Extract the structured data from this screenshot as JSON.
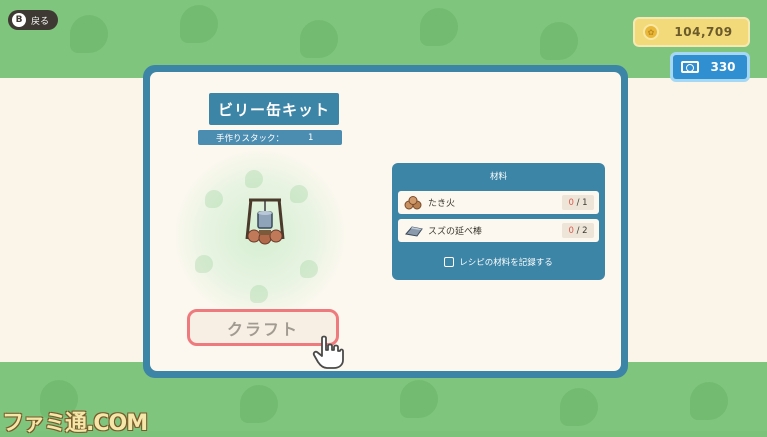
{
  "nav": {
    "back_button_key": "B",
    "back_label": "戻る"
  },
  "wallet": {
    "bells": "104,709",
    "miles": "330",
    "bell_icon": "coin-icon",
    "miles_icon": "ticket-icon"
  },
  "recipe": {
    "title": "ビリー缶キット",
    "stack_label": "手作りスタック：",
    "stack_value": "1",
    "item_icon": "billy-can-kit-icon"
  },
  "materials": {
    "header": "材料",
    "items": [
      {
        "name": "たき火",
        "have": "0",
        "need": "/ 1",
        "icon": "firewood-icon"
      },
      {
        "name": "スズの延べ棒",
        "have": "0",
        "need": "/ 2",
        "icon": "tin-nugget-icon"
      }
    ],
    "record_label": "レシピの材料を記録する"
  },
  "actions": {
    "craft_label": "クラフト"
  },
  "watermark": "ファミ通.COM",
  "colors": {
    "panel": "#3c85a6",
    "craft_border": "#ef7a7e",
    "bells_bg": "#f2d97a",
    "miles_bg": "#2f8fd1",
    "grass": "#80c57d"
  }
}
